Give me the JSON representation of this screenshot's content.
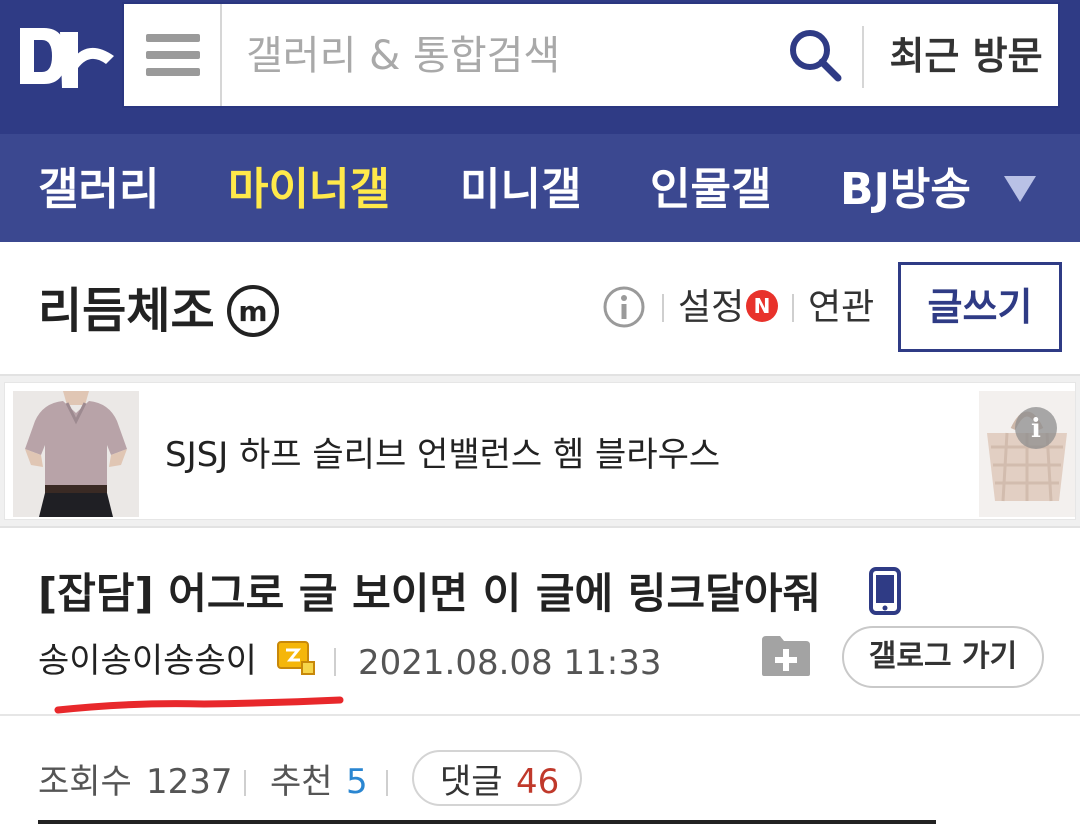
{
  "header": {
    "search_placeholder": "갤러리 & 통합검색",
    "recent_label": "최근 방문"
  },
  "nav": {
    "items": [
      {
        "label": "갤러리",
        "active": false
      },
      {
        "label": "마이너갤",
        "active": true
      },
      {
        "label": "미니갤",
        "active": false
      },
      {
        "label": "인물갤",
        "active": false
      },
      {
        "label": "BJ방송",
        "active": false
      }
    ]
  },
  "gallery": {
    "title": "리듬체조",
    "badge_letter": "m",
    "settings_label": "설정",
    "settings_badge": "N",
    "related_label": "연관",
    "write_label": "글쓰기"
  },
  "ad": {
    "text": "SJSJ 하프 슬리브 언밸런스 헴 블라우스",
    "info_icon": "i"
  },
  "post": {
    "title": "[잡담] 어그로 글 보이면 이 글에 링크달아줘",
    "author": "송이송이송송이",
    "datetime": "2021.08.08 11:33",
    "gallog_label": "갤로그 가기"
  },
  "stats": {
    "views_label": "조회수",
    "views": "1237",
    "recommend_label": "추천",
    "recommend": "5",
    "comments_label": "댓글",
    "comments": "46"
  },
  "colors": {
    "header_bg": "#2f3b85",
    "nav_bg": "#3b4890",
    "active_nav": "#ffe94a",
    "recommend": "#2a86d1",
    "comments": "#c0392b",
    "n_badge": "#e8322b",
    "underline": "#e8282b"
  }
}
